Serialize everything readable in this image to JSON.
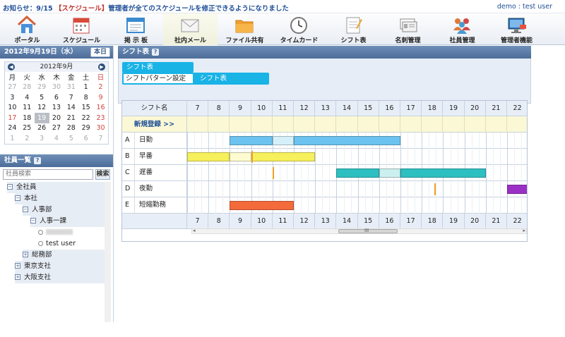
{
  "topbar": {
    "notice_prefix": "お知らせ：9/15 ",
    "notice_tag": "【スケジュール】",
    "notice_text": "管理者が全てのスケジュールを修正できるようになりました",
    "user": "demo : test user"
  },
  "nav": {
    "items": [
      {
        "label": "ポータル",
        "icon": "house-icon"
      },
      {
        "label": "スケジュール",
        "icon": "calendar-icon"
      },
      {
        "label": "掲 示 板",
        "icon": "board-icon"
      },
      {
        "label": "社内メール",
        "icon": "mail-icon"
      },
      {
        "label": "ファイル共有",
        "icon": "folder-icon"
      },
      {
        "label": "タイムカード",
        "icon": "clock-icon"
      },
      {
        "label": "シフト表",
        "icon": "memo-icon"
      },
      {
        "label": "名刺管理",
        "icon": "card-icon"
      },
      {
        "label": "社員管理",
        "icon": "people-icon"
      },
      {
        "label": "管理者機能",
        "icon": "monitor-icon"
      }
    ],
    "active": 3
  },
  "calendar": {
    "header_date": "2012年9月19日（水）",
    "today_label": "本日",
    "month_label": "2012年9月",
    "prev": "◀",
    "next": "▶",
    "weekdays": [
      "月",
      "火",
      "水",
      "木",
      "金",
      "土",
      "日"
    ],
    "weeks": [
      [
        "27",
        "28",
        "29",
        "30",
        "31",
        "1",
        "2"
      ],
      [
        "3",
        "4",
        "5",
        "6",
        "7",
        "8",
        "9"
      ],
      [
        "10",
        "11",
        "12",
        "13",
        "14",
        "15",
        "16"
      ],
      [
        "17",
        "18",
        "19",
        "20",
        "21",
        "22",
        "23"
      ],
      [
        "24",
        "25",
        "26",
        "27",
        "28",
        "29",
        "30"
      ],
      [
        "1",
        "2",
        "3",
        "4",
        "5",
        "6",
        "7"
      ]
    ],
    "today_cell": [
      3,
      2
    ],
    "holiday_cells": [
      [
        3,
        0
      ]
    ]
  },
  "staff": {
    "title": "社員一覧",
    "help": "?",
    "search_placeholder": "社員検索",
    "search_button": "検索",
    "tree": [
      {
        "label": "全社員",
        "level": 0,
        "kind": "minus",
        "sel": true
      },
      {
        "label": "本社",
        "level": 1,
        "kind": "minus",
        "sel": true
      },
      {
        "label": "人事部",
        "level": 2,
        "kind": "minus",
        "sel": true
      },
      {
        "label": "人事一課",
        "level": 3,
        "kind": "minus",
        "sel": true
      },
      {
        "label": "",
        "level": 4,
        "kind": "user-hidden",
        "sel": false
      },
      {
        "label": "test user",
        "level": 4,
        "kind": "user",
        "sel": false
      },
      {
        "label": "総務部",
        "level": 2,
        "kind": "plus",
        "sel": true
      },
      {
        "label": "東京支社",
        "level": 1,
        "kind": "plus",
        "sel": true
      },
      {
        "label": "大阪支社",
        "level": 1,
        "kind": "plus",
        "sel": true
      }
    ]
  },
  "main": {
    "title": "シフト表",
    "help": "?",
    "tab_main": "シフト表",
    "tab_pattern": "シフトパターン設定",
    "tab_shift": "シフト表",
    "grid": {
      "name_header": "シフト名",
      "new_label": "新規登録 >>",
      "scroll_grip": "III",
      "hours": [
        "7",
        "8",
        "9",
        "10",
        "11",
        "12",
        "13",
        "14",
        "15",
        "16",
        "17",
        "18",
        "19",
        "20",
        "21",
        "22"
      ],
      "rows": [
        {
          "key": "A",
          "name": "日勤",
          "segments": [
            [
              9,
              11,
              "#6cc3ef"
            ],
            [
              11,
              12,
              "#d6f0fb"
            ],
            [
              12,
              17,
              "#6cc3ef"
            ]
          ]
        },
        {
          "key": "B",
          "name": "早番",
          "segments": [
            [
              7,
              9,
              "#f6f05c"
            ],
            [
              9,
              10,
              "#fffbd0"
            ],
            [
              10,
              13,
              "#f6f05c"
            ]
          ],
          "mark": 10
        },
        {
          "key": "C",
          "name": "遅番",
          "segments": [
            [
              14,
              16,
              "#2ebfc1"
            ],
            [
              16,
              17,
              "#ccefef"
            ],
            [
              17,
              21,
              "#2ebfc1"
            ]
          ],
          "mark": 11
        },
        {
          "key": "D",
          "name": "夜勤",
          "segments": [
            [
              22,
              23,
              "#9b30c7"
            ]
          ],
          "mark": 18.6
        },
        {
          "key": "E",
          "name": "短縮勤務",
          "segments": [
            [
              9,
              12,
              "#f36a3b"
            ]
          ]
        }
      ]
    }
  }
}
